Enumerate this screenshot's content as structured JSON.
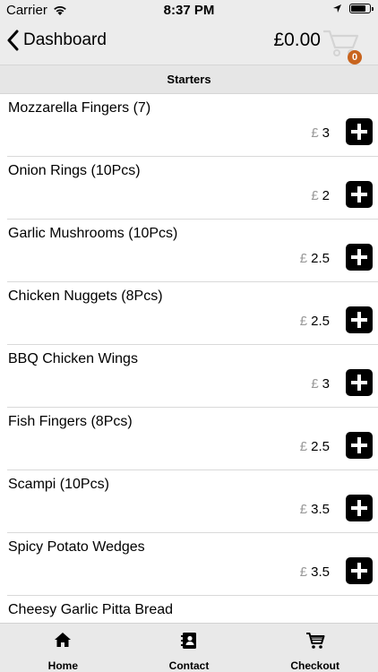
{
  "status_bar": {
    "carrier": "Carrier",
    "time": "8:37 PM"
  },
  "header": {
    "back_label": "Dashboard",
    "cart_total": "£0.00",
    "cart_count": "0"
  },
  "section": {
    "title": "Starters"
  },
  "currency_symbol": "£",
  "items": [
    {
      "name": "Mozzarella Fingers (7)",
      "price": "3"
    },
    {
      "name": "Onion Rings (10Pcs)",
      "price": "2"
    },
    {
      "name": "Garlic Mushrooms (10Pcs)",
      "price": "2.5"
    },
    {
      "name": "Chicken Nuggets (8Pcs)",
      "price": "2.5"
    },
    {
      "name": "BBQ Chicken Wings",
      "price": "3"
    },
    {
      "name": "Fish Fingers (8Pcs)",
      "price": "2.5"
    },
    {
      "name": "Scampi (10Pcs)",
      "price": "3.5"
    },
    {
      "name": "Spicy Potato Wedges",
      "price": "3.5"
    },
    {
      "name": "Cheesy Garlic Pitta Bread",
      "price": ""
    }
  ],
  "tabs": [
    {
      "label": "Home",
      "icon": "home-icon"
    },
    {
      "label": "Contact",
      "icon": "contacts-icon"
    },
    {
      "label": "Checkout",
      "icon": "cart-icon"
    }
  ],
  "colors": {
    "badge": "#c8641e",
    "bars": "#ececec",
    "add_button": "#000000"
  }
}
